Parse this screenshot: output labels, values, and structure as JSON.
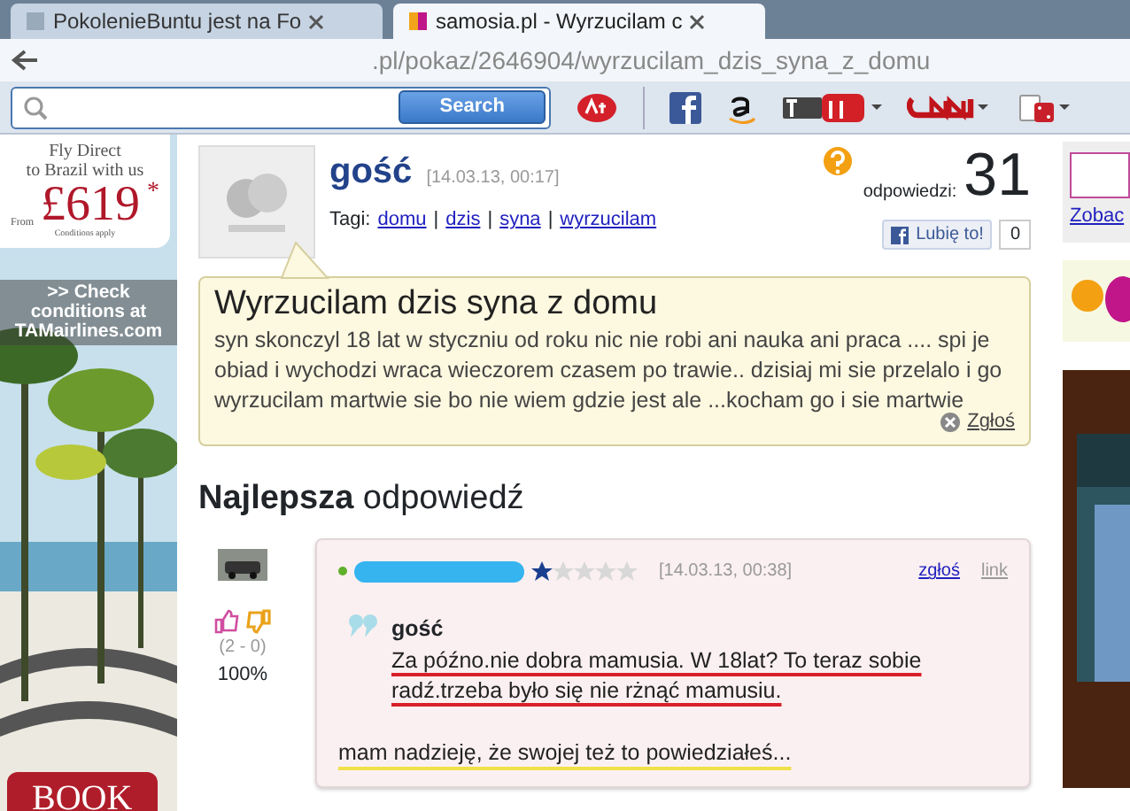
{
  "browser": {
    "tabs": [
      {
        "label": "PokolenieBuntu jest na Fo",
        "selected": false
      },
      {
        "label": "samosia.pl - Wyrzucilam c",
        "selected": true
      }
    ],
    "address": ".pl/pokaz/2646904/wyrzucilam_dzis_syna_z_domu"
  },
  "toolbar": {
    "search_button": "Search",
    "items": [
      {
        "kind": "ask"
      },
      {
        "kind": "facebook"
      },
      {
        "kind": "amazon"
      },
      {
        "kind": "youtube"
      },
      {
        "kind": "cnn"
      },
      {
        "kind": "game"
      }
    ]
  },
  "ad": {
    "line_1": "Fly Direct",
    "line_2": "to Brazil with us",
    "from": "From",
    "price": "£619",
    "mark": "*",
    "note": "Conditions apply",
    "link": ">> Check conditions at TAMairlines.com",
    "button": "BOOK"
  },
  "question": {
    "author": "gość",
    "date": "[14.03.13, 00:17]",
    "tags_label": "Tagi:",
    "tags": [
      "domu",
      "dzis",
      "syna",
      "wyrzucilam"
    ],
    "tag_separator": "|",
    "answers_label": "odpowiedzi:",
    "answers": "31",
    "like": "Lubię to!",
    "like_count": "0",
    "title": "Wyrzucilam dzis syna z domu",
    "body": "syn skonczyl 18 lat w styczniu od roku nic nie robi ani nauka ani praca .... spi je obiad i wychodzi wraca wieczorem czasem po trawie.. dzisiaj mi sie przelalo i go wyrzucilam martwie sie bo nie wiem gdzie jest ale ...kocham go i sie martwie",
    "report": "Zgłoś"
  },
  "best": {
    "heading_bold": "Najlepsza",
    "heading": "odpowiedź",
    "votes": "(2 - 0)",
    "percent": "100%",
    "stars": 1,
    "date": "[14.03.13, 00:38]",
    "report": "zgłoś",
    "link": "link",
    "quote_author": "gość",
    "quote": "Za późno.nie dobra mamusia. W 18lat? To teraz sobie radź.trzeba było się nie rżnąć mamusiu.",
    "reply": "mam nadzieję, że swojej też to powiedziałeś..."
  },
  "right": {
    "link": "Zobac"
  }
}
